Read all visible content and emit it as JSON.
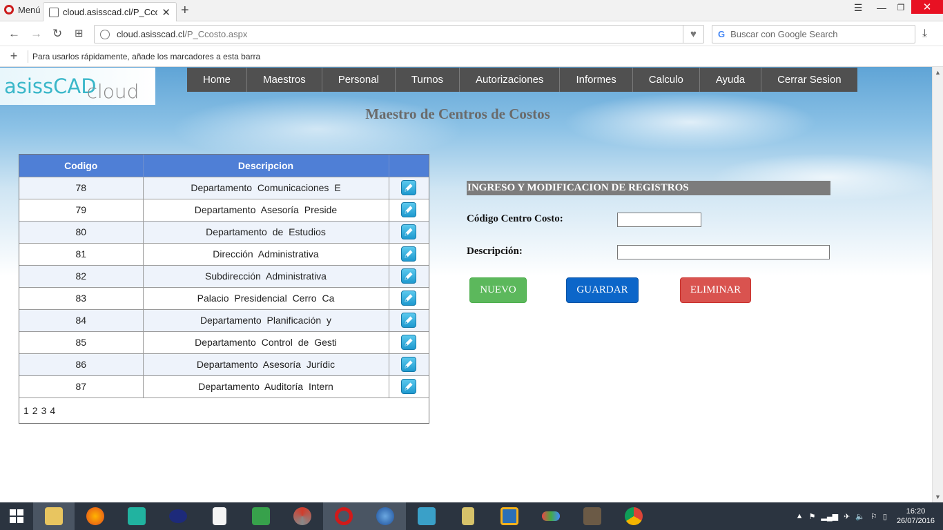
{
  "browser": {
    "menu_label": "Menú",
    "tab_title": "cloud.asisscad.cl/P_Ccosto",
    "url_host": "cloud.asisscad.cl",
    "url_path": "/P_Ccosto.aspx",
    "search_placeholder": "Buscar con Google Search",
    "bookmarks_hint": "Para usarlos rápidamente, añade los marcadores a esta barra"
  },
  "logo": {
    "main": "asissCAD",
    "suffix": "cloud"
  },
  "nav": [
    "Home",
    "Maestros",
    "Personal",
    "Turnos",
    "Autorizaciones",
    "Informes",
    "Calculo",
    "Ayuda",
    "Cerrar Sesion"
  ],
  "page_title": "Maestro de Centros de Costos",
  "table": {
    "headers": [
      "Codigo",
      "Descripcion",
      ""
    ],
    "rows": [
      {
        "codigo": "78",
        "descripcion": "Departamento Comunicaciones E"
      },
      {
        "codigo": "79",
        "descripcion": "Departamento Asesoría Preside"
      },
      {
        "codigo": "80",
        "descripcion": "Departamento de Estudios"
      },
      {
        "codigo": "81",
        "descripcion": "Dirección Administrativa"
      },
      {
        "codigo": "82",
        "descripcion": "Subdirección Administrativa"
      },
      {
        "codigo": "83",
        "descripcion": "Palacio Presidencial Cerro Ca"
      },
      {
        "codigo": "84",
        "descripcion": "Departamento Planificación y"
      },
      {
        "codigo": "85",
        "descripcion": "Departamento Control de Gesti"
      },
      {
        "codigo": "86",
        "descripcion": "Departamento Asesoría Jurídic"
      },
      {
        "codigo": "87",
        "descripcion": "Departamento Auditoría Intern"
      }
    ],
    "pages": [
      "1",
      "2",
      "3",
      "4"
    ]
  },
  "form": {
    "header": "INGRESO Y MODIFICACION DE REGISTROS",
    "codigo_label": "Código Centro Costo:",
    "codigo_value": "",
    "descripcion_label": "Descripción:",
    "descripcion_value": "",
    "buttons": {
      "nuevo": "NUEVO",
      "guardar": "GUARDAR",
      "eliminar": "ELIMINAR"
    }
  },
  "taskbar": {
    "time": "16:20",
    "date": "26/07/2016"
  },
  "colors": {
    "nav_bg": "#505050",
    "table_header": "#4f7fd6",
    "btn_new": "#5cb85c",
    "btn_save": "#0c66c9",
    "btn_delete": "#d9534f"
  }
}
